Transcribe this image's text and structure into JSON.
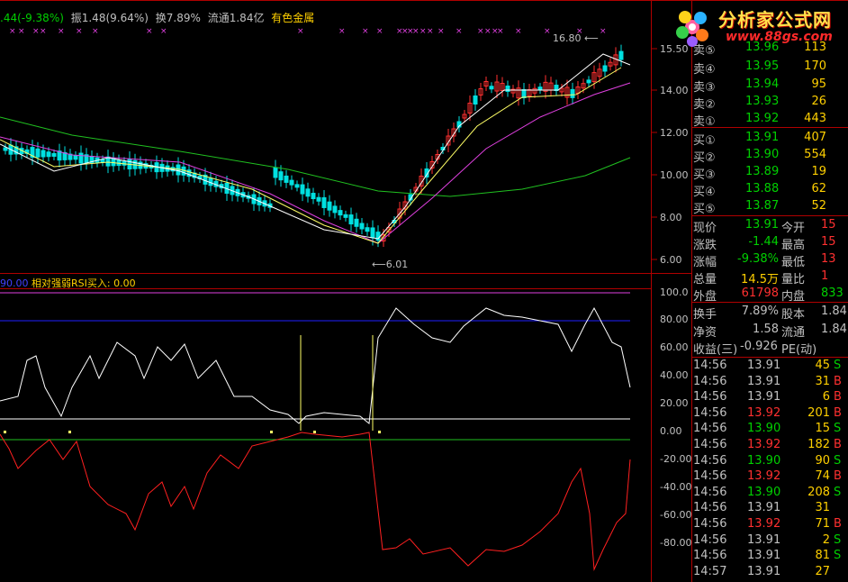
{
  "header": {
    "change": ".44(-9.38%)",
    "amplitude": "振1.48(9.64%)",
    "turnover": "换7.89%",
    "float": "流通1.84亿",
    "sector": "有色金属"
  },
  "indicator_header": {
    "value_prefix": "90.00",
    "name": "相对强弱RSI买入: 0.00"
  },
  "price_axis": [
    "14.00",
    "12.00",
    "10.00",
    "8.00",
    "6.00"
  ],
  "price_axis_top": "15.50",
  "rsi_axis": [
    "100.0",
    "80.00",
    "60.00",
    "40.00",
    "20.00",
    "0.00",
    "-20.00",
    "-40.00",
    "-60.00",
    "-80.00"
  ],
  "annotations": {
    "high": "16.80",
    "low": "6.01"
  },
  "logo": {
    "title": "分析家公式网",
    "url": "www.88gs.com"
  },
  "order_book": {
    "asks": [
      {
        "label": "卖⑤",
        "price": "13.96",
        "vol": "113"
      },
      {
        "label": "卖④",
        "price": "13.95",
        "vol": "170"
      },
      {
        "label": "卖③",
        "price": "13.94",
        "vol": "95"
      },
      {
        "label": "卖②",
        "price": "13.93",
        "vol": "26"
      },
      {
        "label": "卖①",
        "price": "13.92",
        "vol": "443"
      }
    ],
    "bids": [
      {
        "label": "买①",
        "price": "13.91",
        "vol": "407"
      },
      {
        "label": "买②",
        "price": "13.90",
        "vol": "554"
      },
      {
        "label": "买③",
        "price": "13.89",
        "vol": "19"
      },
      {
        "label": "买④",
        "price": "13.88",
        "vol": "62"
      },
      {
        "label": "买⑤",
        "price": "13.87",
        "vol": "52"
      }
    ]
  },
  "quote": {
    "now_label": "现价",
    "now": "13.91",
    "open_label": "今开",
    "open": "15",
    "chg_label": "涨跌",
    "chg": "-1.44",
    "high_label": "最高",
    "high": "15",
    "pct_label": "涨幅",
    "pct": "-9.38%",
    "low_label": "最低",
    "low": "13",
    "vol_label": "总量",
    "vol": "14.5万",
    "vr_label": "量比",
    "vr": "1",
    "out_label": "外盘",
    "out": "61798",
    "in_label": "内盘",
    "in": "833",
    "hs_label": "换手",
    "hs": "7.89%",
    "gb_label": "股本",
    "gb": "1.84",
    "nav_label": "净资",
    "nav": "1.58",
    "lt_label": "流通",
    "lt": "1.84",
    "eps_label": "收益(三)",
    "eps": "-0.926",
    "pe_label": "PE(动)"
  },
  "ticks": [
    {
      "t": "14:56",
      "p": "13.91",
      "v": "45",
      "bs": "S"
    },
    {
      "t": "14:56",
      "p": "13.91",
      "v": "31",
      "bs": "B"
    },
    {
      "t": "14:56",
      "p": "13.91",
      "v": "6",
      "bs": "B"
    },
    {
      "t": "14:56",
      "p": "13.92",
      "v": "201",
      "bs": "B"
    },
    {
      "t": "14:56",
      "p": "13.90",
      "v": "15",
      "bs": "S"
    },
    {
      "t": "14:56",
      "p": "13.92",
      "v": "182",
      "bs": "B"
    },
    {
      "t": "14:56",
      "p": "13.90",
      "v": "90",
      "bs": "S"
    },
    {
      "t": "14:56",
      "p": "13.92",
      "v": "74",
      "bs": "B"
    },
    {
      "t": "14:56",
      "p": "13.90",
      "v": "208",
      "bs": "S"
    },
    {
      "t": "14:56",
      "p": "13.91",
      "v": "31",
      "bs": ""
    },
    {
      "t": "14:56",
      "p": "13.92",
      "v": "71",
      "bs": "B"
    },
    {
      "t": "14:56",
      "p": "13.91",
      "v": "2",
      "bs": "S"
    },
    {
      "t": "14:56",
      "p": "13.91",
      "v": "81",
      "bs": "S"
    },
    {
      "t": "14:57",
      "p": "13.91",
      "v": "27",
      "bs": ""
    }
  ],
  "colors": {
    "up": "#ff3030",
    "down": "#00e0e0",
    "ma5": "#ffffff",
    "ma10": "#ffff66",
    "ma20": "#e040e0",
    "ma60": "#20c020",
    "rsi": "#ffffff",
    "rsi2": "#ff2020",
    "frame": "#b00000"
  }
}
